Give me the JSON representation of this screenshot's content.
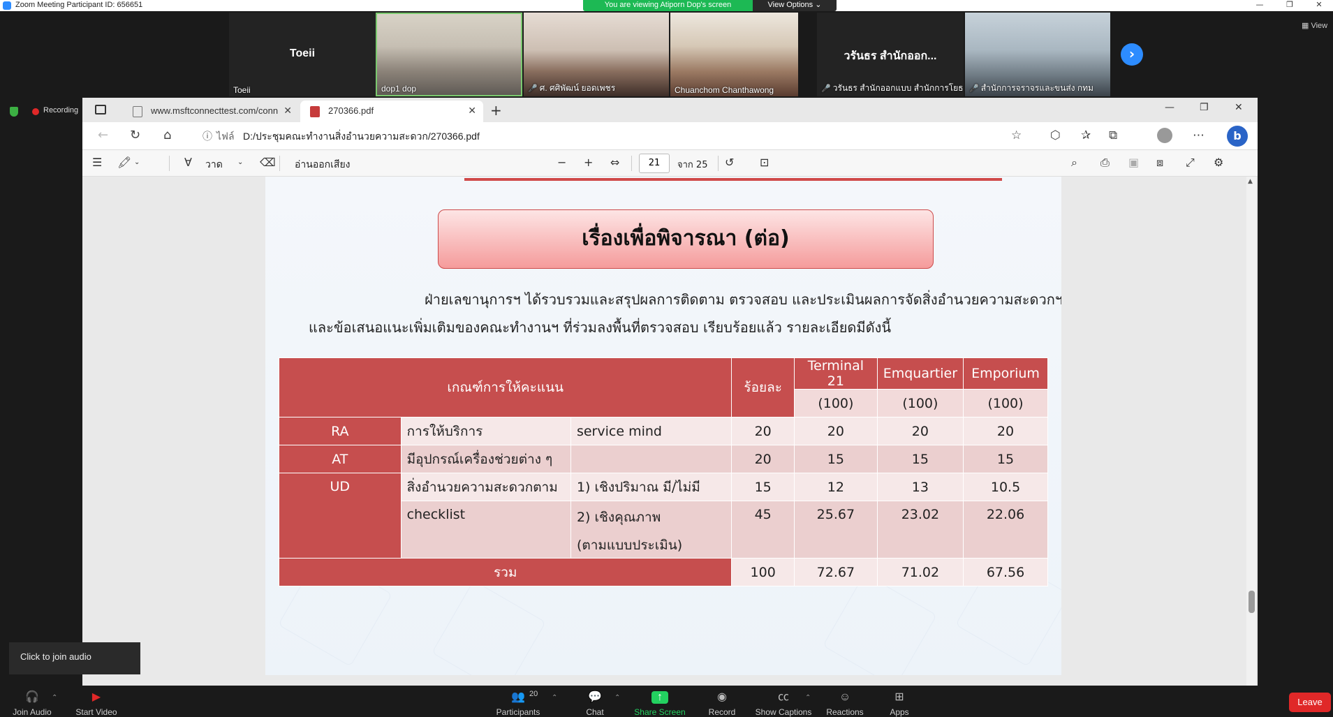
{
  "zoom": {
    "title": "Zoom Meeting Participant ID: 656651",
    "viewing_banner": "You are viewing Atiporn Dop's screen",
    "view_options": "View Options ⌄",
    "view_label": "View",
    "recording": "Recording",
    "join_audio_tip": "Click to join audio",
    "thumbnails": [
      {
        "big": "Toeii",
        "small": "Toeii",
        "muted": false
      },
      {
        "big": "",
        "small": "dop1 dop",
        "muted": false
      },
      {
        "big": "",
        "small": "ศ. ศศิพัฒน์ ยอดเพชร",
        "muted": true
      },
      {
        "big": "",
        "small": "Chuanchom Chanthawong",
        "muted": false
      },
      {
        "big": "วรันธร สำนักออก...",
        "small": "วรันธร สำนักออกแบบ สำนักการโยธา",
        "muted": true
      },
      {
        "big": "",
        "small": "สำนักการจราจรและขนส่ง กทม",
        "muted": true
      }
    ],
    "toolbar": {
      "join_audio": "Join Audio",
      "start_video": "Start Video",
      "participants": "Participants",
      "participants_count": "20",
      "chat": "Chat",
      "share_screen": "Share Screen",
      "record": "Record",
      "show_captions": "Show Captions",
      "reactions": "Reactions",
      "apps": "Apps",
      "leave": "Leave"
    }
  },
  "browser": {
    "tabs": [
      {
        "title": "www.msftconnecttest.com/conn"
      },
      {
        "title": "270366.pdf"
      }
    ],
    "url_label": "ไฟล์",
    "url": "D:/ประชุมคณะทำงานสิ่งอำนวยความสะดวก/270366.pdf"
  },
  "pdf_toolbar": {
    "draw_label": "วาด",
    "read_aloud": "อ่านออกเสียง",
    "page_current": "21",
    "page_total": "จาก 25"
  },
  "pdf_page": {
    "title": "เรื่องเพื่อพิจารณา (ต่อ)",
    "paragraph_line1": "ฝ่ายเลขานุการฯ ได้รวบรวมและสรุปผลการติดตาม ตรวจสอบ และประเมินผลการจัดสิ่งอำนวยความสะดวกฯ",
    "paragraph_line2": "และข้อเสนอแนะเพิ่มเติมของคณะทำงานฯ ที่ร่วมลงพื้นที่ตรวจสอบ เรียบร้อยแล้ว รายละเอียดมีดังนี้",
    "table": {
      "header_criteria": "เกณฑ์การให้คะแนน",
      "header_percent": "ร้อยละ",
      "venues": [
        "Terminal 21",
        "Emquartier",
        "Emporium"
      ],
      "venue_max": [
        "(100)",
        "(100)",
        "(100)"
      ],
      "rows": [
        {
          "code": "RA",
          "item": "การให้บริการ",
          "detail": "service mind",
          "percent": "20",
          "scores": [
            "20",
            "20",
            "20"
          ]
        },
        {
          "code": "AT",
          "item": "มีอุปกรณ์เครื่องช่วยต่าง ๆ",
          "detail": "",
          "percent": "20",
          "scores": [
            "15",
            "15",
            "15"
          ]
        },
        {
          "code": "UD",
          "item": "สิ่งอำนวยความสะดวกตาม",
          "detail": "1) เชิงปริมาณ มี/ไม่มี",
          "percent": "15",
          "scores": [
            "12",
            "13",
            "10.5"
          ]
        },
        {
          "code": "",
          "item": "checklist",
          "detail": "2) เชิงคุณภาพ",
          "detail2": "(ตามแบบประเมิน)",
          "percent": "45",
          "scores": [
            "25.67",
            "23.02",
            "22.06"
          ]
        }
      ],
      "total_label": "รวม",
      "total_percent": "100",
      "total_scores": [
        "72.67",
        "71.02",
        "67.56"
      ]
    }
  }
}
